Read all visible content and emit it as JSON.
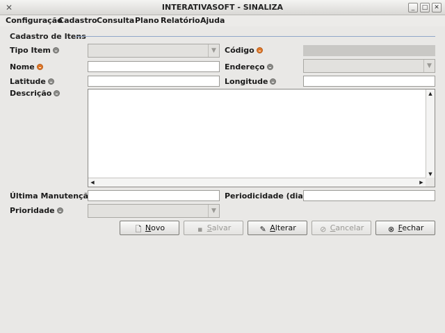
{
  "window": {
    "title": "INTERATIVASOFT - SINALIZA",
    "app_icon": "x-app-icon",
    "controls": [
      "minimize-icon",
      "maximize-icon",
      "close-icon"
    ]
  },
  "menu": [
    "Configuração",
    "Cadastro",
    "Consulta",
    "Plano",
    "Relatório",
    "Ajuda"
  ],
  "group": {
    "title": "Cadastro de Itens"
  },
  "fields": {
    "tipo_item": {
      "label": "Tipo Item",
      "value": ""
    },
    "codigo": {
      "label": "Código",
      "value": ""
    },
    "nome": {
      "label": "Nome",
      "value": ""
    },
    "endereco": {
      "label": "Endereço",
      "value": ""
    },
    "latitude": {
      "label": "Latitude",
      "value": ""
    },
    "longitude": {
      "label": "Longitude",
      "value": ""
    },
    "descricao": {
      "label": "Descrição",
      "value": ""
    },
    "ultima_manutencao": {
      "label": "Última Manutenção",
      "value": ""
    },
    "periodicidade": {
      "label": "Periodicidade (dias)",
      "value": ""
    },
    "prioridade": {
      "label": "Prioridade",
      "value": ""
    }
  },
  "buttons": {
    "novo": {
      "mnemonic": "N",
      "rest": "ovo",
      "icon": "new-document-icon",
      "enabled": true
    },
    "salvar": {
      "mnemonic": "S",
      "rest": "alvar",
      "icon": "save-icon",
      "enabled": false
    },
    "alterar": {
      "mnemonic": "A",
      "rest": "lterar",
      "icon": "edit-icon",
      "enabled": true
    },
    "cancelar": {
      "mnemonic": "C",
      "rest": "ancelar",
      "icon": "cancel-icon",
      "enabled": false
    },
    "fechar": {
      "mnemonic": "F",
      "rest": "echar",
      "icon": "close-circle-icon",
      "enabled": true
    }
  },
  "colors": {
    "required_indicator": "#e07a2c",
    "optional_indicator": "#8d8d8a",
    "group_line": "#8fa6c8"
  }
}
